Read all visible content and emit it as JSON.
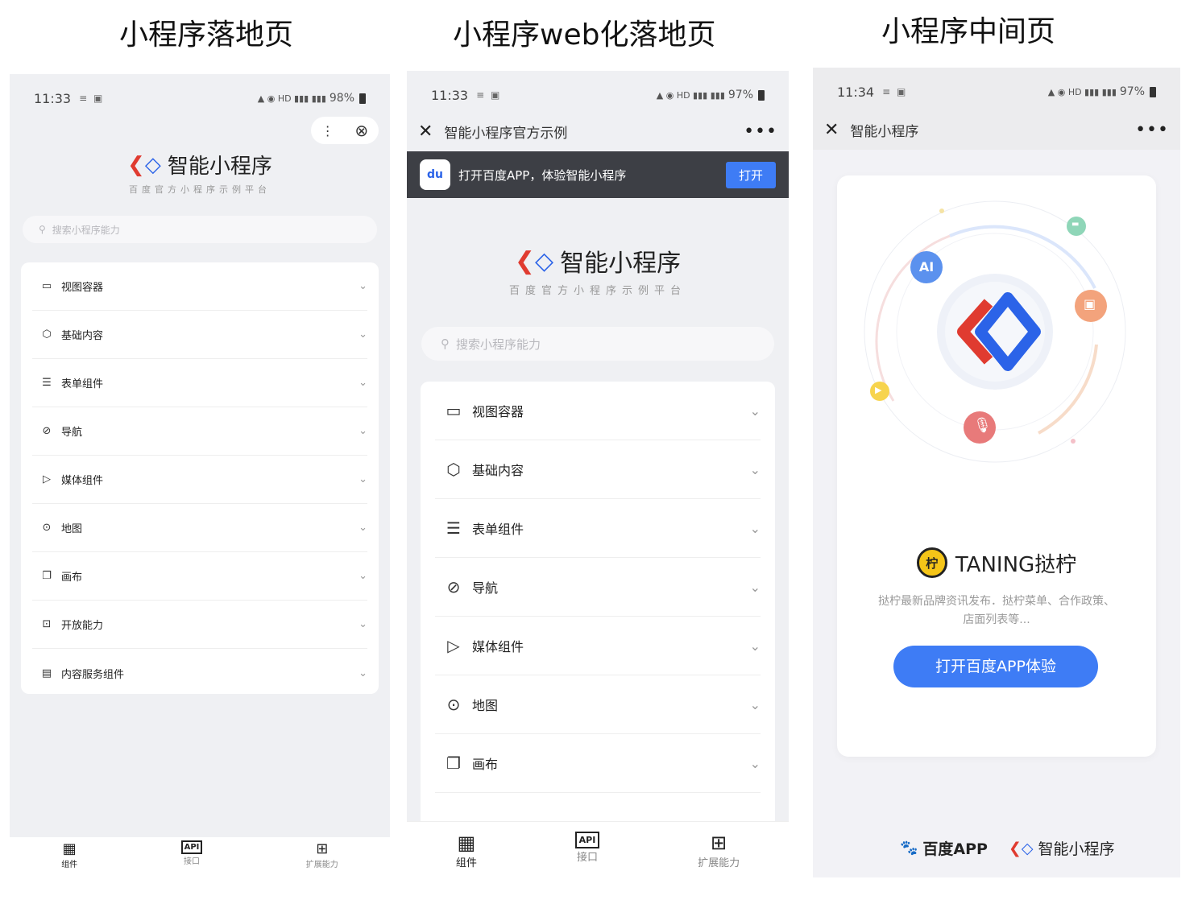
{
  "captions": [
    "小程序落地页",
    "小程序web化落地页",
    "小程序中间页"
  ],
  "p1": {
    "time": "11:33",
    "status_right": "98%",
    "brand": "智能小程序",
    "sub": "百度官方小程序示例平台",
    "search_placeholder": "搜索小程序能力",
    "rows": [
      "视图容器",
      "基础内容",
      "表单组件",
      "导航",
      "媒体组件",
      "地图",
      "画布",
      "开放能力",
      "内容服务组件"
    ],
    "tabs": [
      "组件",
      "接口",
      "扩展能力"
    ]
  },
  "p2": {
    "time": "11:33",
    "status_right": "97%",
    "title": "智能小程序官方示例",
    "banner_text": "打开百度APP，体验智能小程序",
    "banner_btn": "打开",
    "brand": "智能小程序",
    "sub": "百度官方小程序示例平台",
    "search_placeholder": "搜索小程序能力",
    "rows": [
      "视图容器",
      "基础内容",
      "表单组件",
      "导航",
      "媒体组件",
      "地图",
      "画布"
    ],
    "tabs": [
      "组件",
      "接口",
      "扩展能力"
    ]
  },
  "p3": {
    "time": "11:34",
    "status_right": "97%",
    "title": "智能小程序",
    "ai_label": "AI",
    "app_name": "TANING挞柠",
    "app_desc": "挞柠最新品牌资讯发布．挞柠菜单、合作政策、店面列表等...",
    "cta": "打开百度APP体验",
    "footer_baidu": "百度APP",
    "footer_mp": "智能小程序"
  },
  "icons": {
    "rows": [
      "view-container-icon",
      "cube-icon",
      "list-icon",
      "compass-icon",
      "play-icon",
      "map-pin-icon",
      "canvas-icon",
      "chart-icon",
      "doc-icon"
    ]
  },
  "colors": {
    "accent": "#3e7cf5",
    "brand_red": "#e03b30",
    "brand_blue": "#2b63e8",
    "bg": "#eff0f3"
  }
}
